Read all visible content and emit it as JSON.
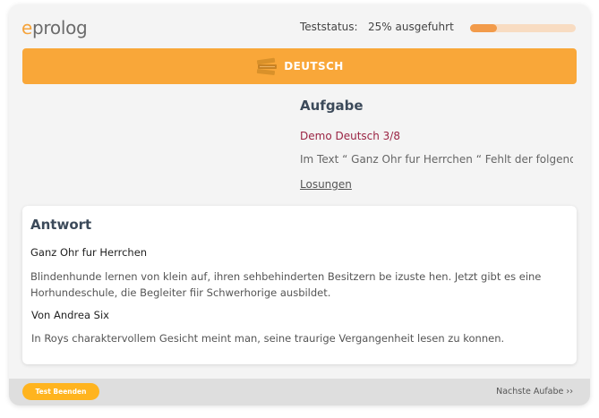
{
  "header": {
    "logo_e": "e",
    "logo_rest": "prolog",
    "status_label": "Teststatus:",
    "status_value": "25% ausgefuhrt",
    "progress_fraction": 0.25,
    "progress_color": "#f29b4a"
  },
  "banner": {
    "icon": "books-icon",
    "text": "DEUTSCH",
    "color": "#f9a739"
  },
  "task": {
    "title": "Aufgabe",
    "name": "Demo Deutsch 3/8",
    "text": "Im Text “ Ganz Ohr fur Herrchen “ Fehlt der folgend",
    "solutions_link": "Losungen"
  },
  "answer": {
    "title": "Antwort",
    "heading": "Ganz Ohr fur Herrchen",
    "paragraph1": "Blindenhunde lernen von klein auf, ihren sehbehinderten Besitzern be izuste hen. Jetzt gibt es eine Horhundeschule, die Begleiter fiir Schwerhorige ausbildet.",
    "author": "Von Andrea Six",
    "paragraph2": "In Roys charaktervollem Gesicht meint man, seine traurige Vergangenheit lesen zu konnen."
  },
  "footer": {
    "end_button": "Test Beenden",
    "next_link": "Nachste Aufabe ››"
  }
}
